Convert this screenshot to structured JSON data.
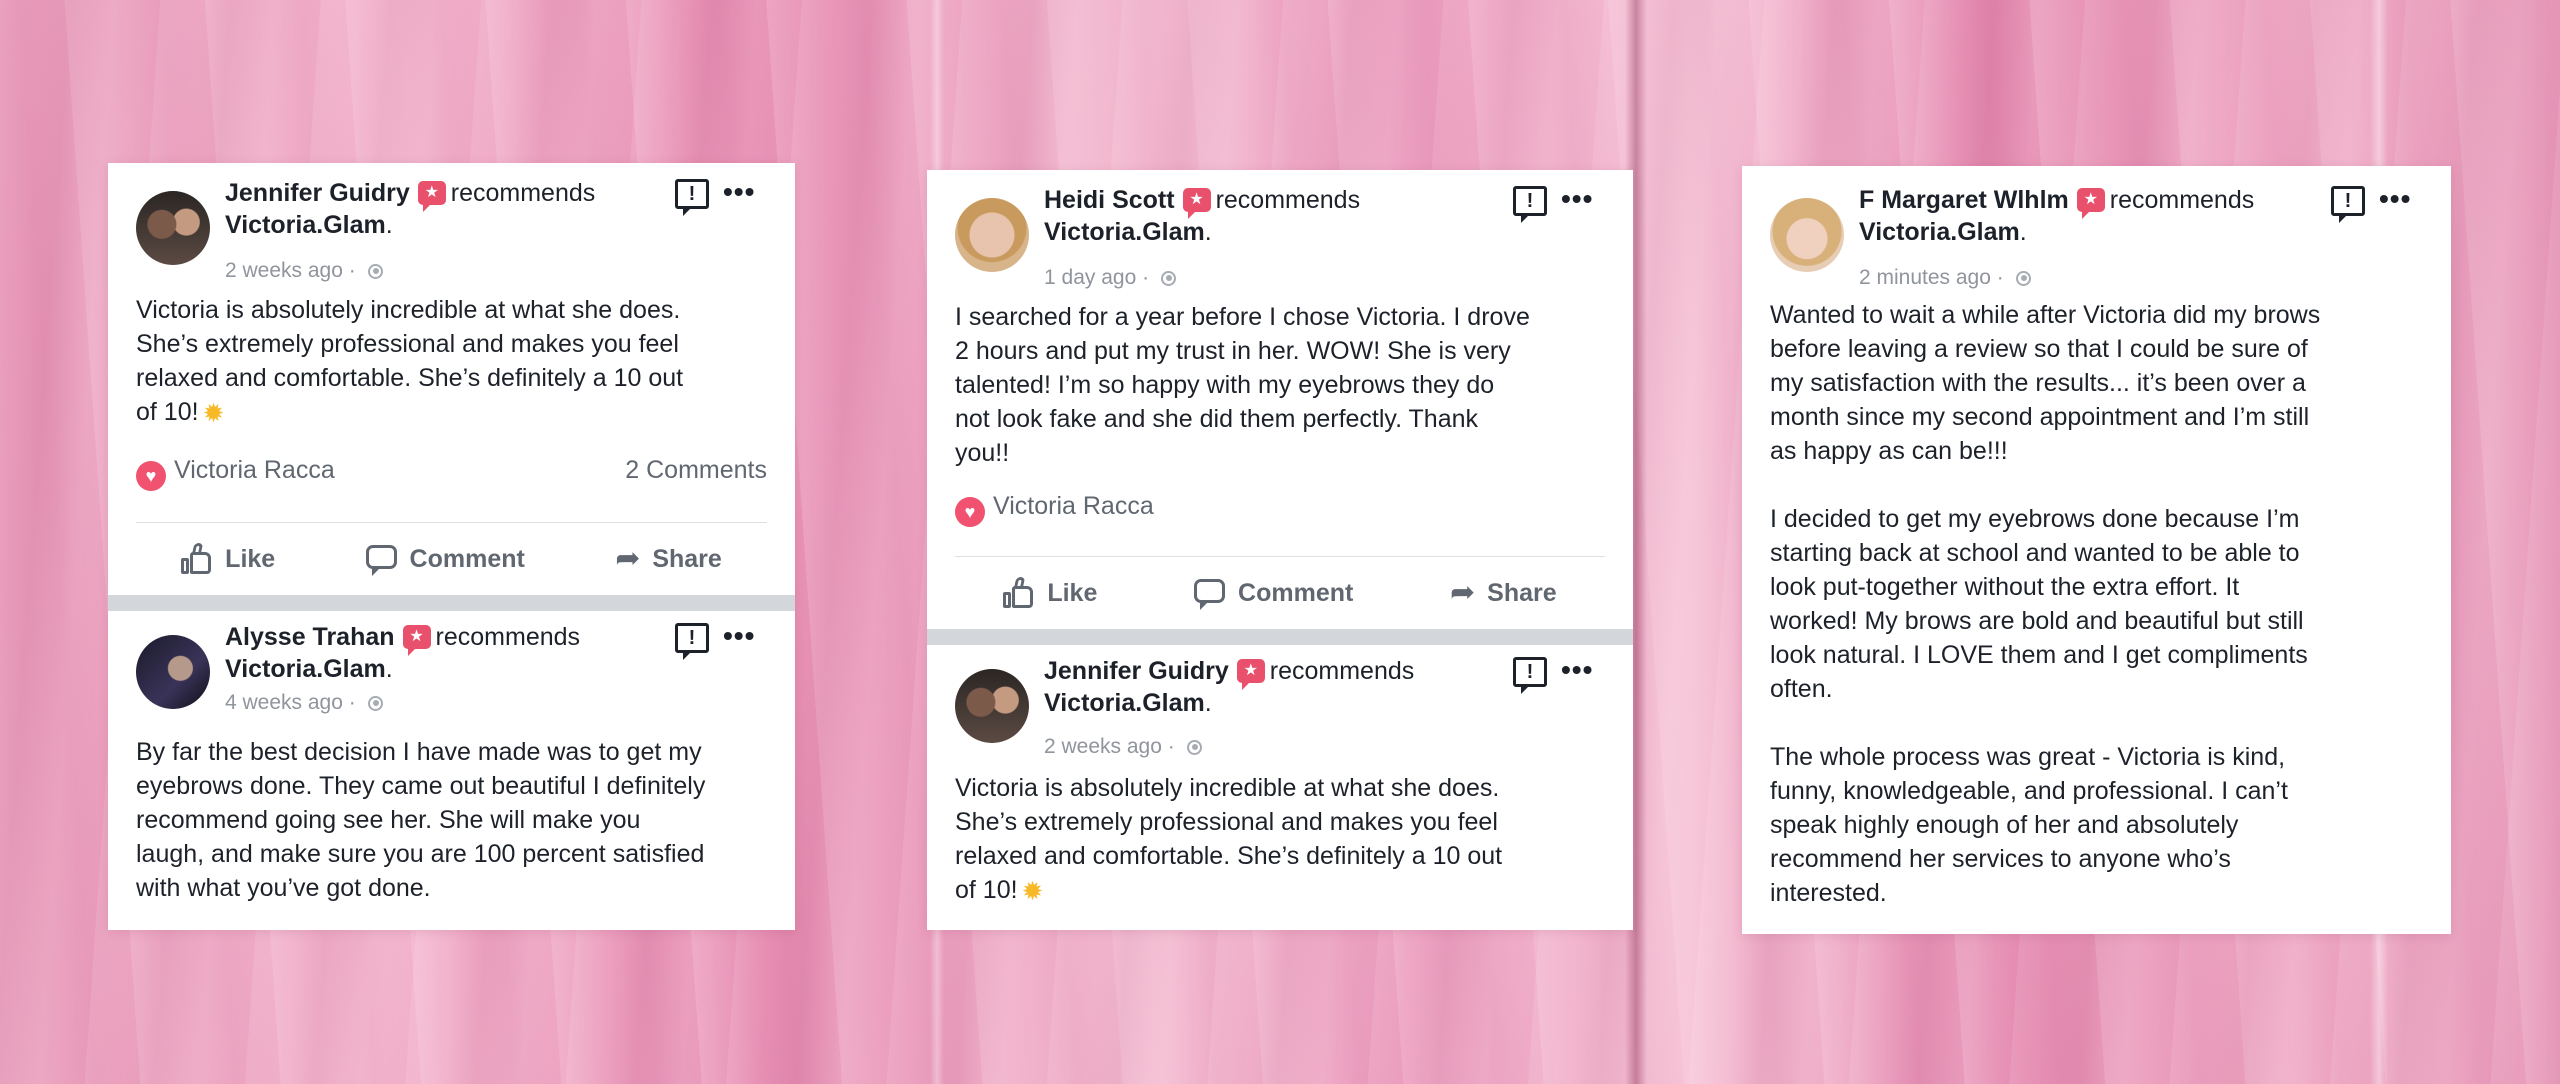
{
  "recommends_text": "recommends",
  "page_name": "Victoria.Glam",
  "actions": {
    "like": "Like",
    "comment": "Comment",
    "share": "Share"
  },
  "card1": {
    "post1": {
      "author": "Jennifer Guidry",
      "time": "2 weeks ago",
      "text": "Victoria is absolutely incredible at what she does.\nShe’s extremely professional and makes you feel\nrelaxed and comfortable. She’s definitely a 10 out\nof 10!",
      "reactor": "Victoria Racca",
      "comments": "2 Comments"
    },
    "post2": {
      "author": "Alysse Trahan",
      "time": "4 weeks ago",
      "text": "By far the best decision I have made was to get my\neyebrows done. They came out beautiful I definitely\nrecommend going see her. She will make you\nlaugh, and make sure you are 100 percent satisfied\nwith what you’ve got done."
    }
  },
  "card2": {
    "post1": {
      "author": "Heidi Scott",
      "time": "1 day ago",
      "text": "I searched for a year before I chose Victoria. I drove\n2 hours and put my trust in her. WOW! She is very\ntalented! I’m so happy with my eyebrows they do\nnot look fake and she did them perfectly. Thank\nyou!!",
      "reactor": "Victoria Racca"
    },
    "post2": {
      "author": "Jennifer Guidry",
      "time": "2 weeks ago",
      "text": "Victoria is absolutely incredible at what she does.\nShe’s extremely professional and makes you feel\nrelaxed and comfortable. She’s definitely a 10 out\nof 10!"
    }
  },
  "card3": {
    "post1": {
      "author": "F Margaret Wlhlm",
      "time": "2 minutes ago",
      "text": "Wanted to wait a while after Victoria did my brows\nbefore leaving a review so that I could be sure of\nmy satisfaction with the results... it’s been over a\nmonth since my second appointment and I’m still\nas happy as can be!!!\n\nI decided to get my eyebrows done because I’m\nstarting back at school and wanted to be able to\nlook put-together without the extra effort. It\nworked! My brows are bold and beautiful but still\nlook natural. I LOVE them and I get compliments\noften.\n\nThe whole process was great - Victoria is kind,\nfunny, knowledgeable, and professional. I can’t\nspeak highly enough of her and absolutely\nrecommend her services to anyone who’s\ninterested."
    }
  },
  "icons": {
    "recommend_badge": "recommend-flag-icon",
    "privacy": "globe-icon",
    "report": "report-icon",
    "more": "more-icon",
    "reaction": "heart-icon",
    "emoji": "sparkle-emoji"
  },
  "colors": {
    "accent": "#e9506b",
    "text": "#1d2129",
    "meta": "#90949c"
  }
}
